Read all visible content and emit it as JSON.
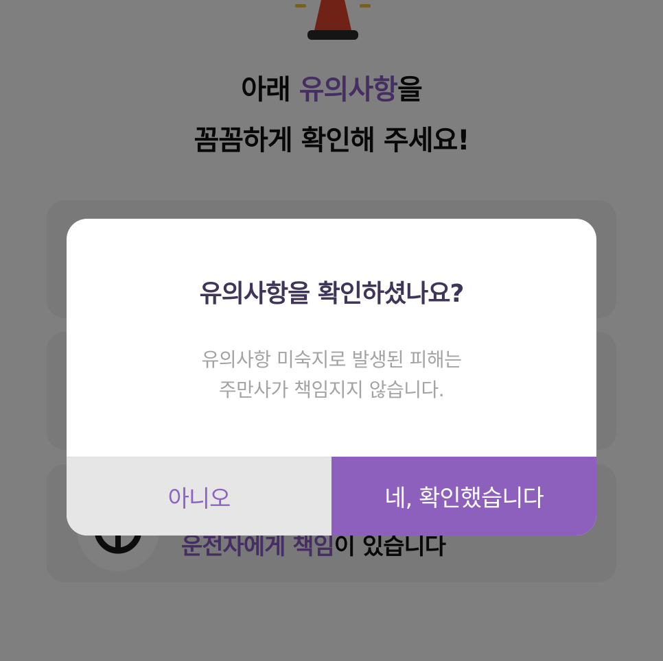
{
  "heading": {
    "line1_prefix": "아래 ",
    "line1_accent": "유의사항",
    "line1_suffix": "을",
    "line2": "꼼꼼하게 확인해 주세요!"
  },
  "cards": [
    {
      "icon": "notice-icon"
    },
    {
      "icon": "notice-icon"
    },
    {
      "icon": "steering-wheel-icon",
      "text_accent": "운전자에게 책임",
      "text_rest": "이 있습니다"
    }
  ],
  "dialog": {
    "title": "유의사항을 확인하셨나요?",
    "message_line1": "유의사항 미숙지로 발생된 피해는",
    "message_line2": "주만사가 책임지지 않습니다.",
    "no_label": "아니오",
    "yes_label": "네, 확인했습니다"
  },
  "colors": {
    "accent": "#8e60be",
    "title": "#3f3559",
    "overlay": "rgba(0,0,0,0.5)"
  }
}
